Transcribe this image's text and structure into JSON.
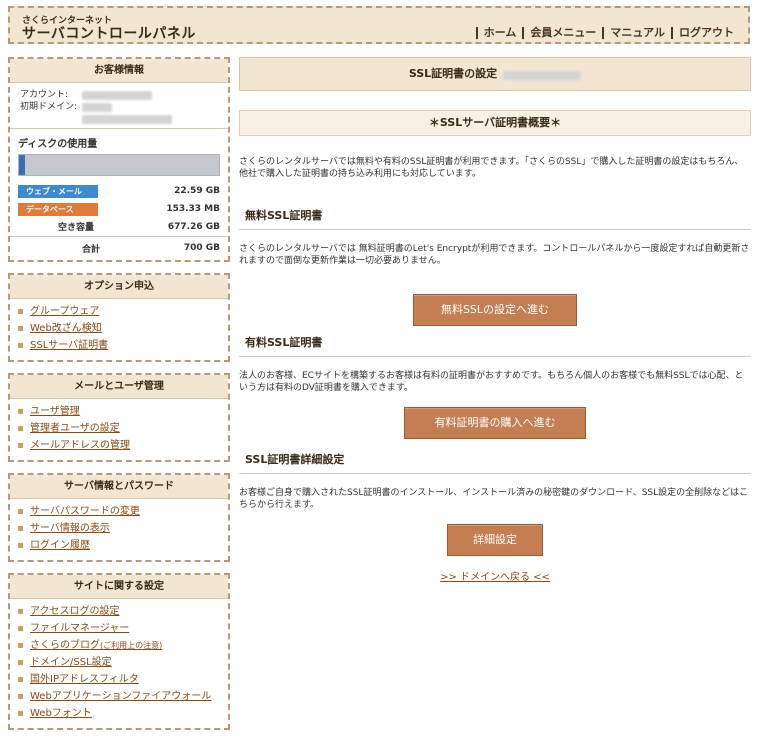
{
  "header": {
    "brand_small": "さくらインターネット",
    "brand_big": "サーバコントロールパネル",
    "nav": [
      "ホーム",
      "会員メニュー",
      "マニュアル",
      "ログアウト"
    ]
  },
  "customer": {
    "title": "お客様情報",
    "account_label": "アカウント:",
    "domain_label": "初期ドメイン:"
  },
  "disk": {
    "title": "ディスクの使用量",
    "usage_fraction": 0.03,
    "rows": [
      {
        "label": "ウェブ・メール",
        "value": "22.59 GB"
      },
      {
        "label": "データベース",
        "value": "153.33 MB"
      }
    ],
    "free_label": "空き容量",
    "free_value": "677.26 GB",
    "total_label": "合計",
    "total_value": "700 GB"
  },
  "menus": {
    "option": {
      "title": "オプション申込",
      "items": [
        "グループウェア",
        "Web改ざん検知",
        "SSLサーバ証明書"
      ]
    },
    "mail": {
      "title": "メールとユーザ管理",
      "items": [
        "ユーザ管理",
        "管理者ユーザの設定",
        "メールアドレスの管理"
      ]
    },
    "server": {
      "title": "サーバ情報とパスワード",
      "items": [
        "サーバパスワードの変更",
        "サーバ情報の表示",
        "ログイン履歴"
      ]
    },
    "site": {
      "title": "サイトに関する設定",
      "items": [
        "アクセスログの設定",
        "ファイルマネージャー",
        "さくらのブログ",
        "ドメイン/SSL設定",
        "国外IPアドレスフィルタ",
        "Webアプリケーションファイアウォール",
        "Webフォント"
      ],
      "blog_note": "(ご利用上の注意)"
    }
  },
  "main": {
    "title": "SSL証明書の設定",
    "overview_title": "＊SSLサーバ証明書概要＊",
    "intro": "さくらのレンタルサーバでは無料や有料のSSL証明書が利用できます。「さくらのSSL」で購入した証明書の設定はもちろん、他社で購入した証明書の持ち込み利用にも対応しています。",
    "free_title": "無料SSL証明書",
    "free_text": "さくらのレンタルサーバでは 無料証明書のLet's Encryptが利用できます。コントロールパネルから一度設定すれば自動更新されますので面倒な更新作業は一切必要ありません。",
    "free_button": "無料SSLの設定へ進む",
    "paid_title": "有料SSL証明書",
    "paid_text": "法人のお客様、ECサイトを構築するお客様は有料の証明書がおすすめです。もちろん個人のお客様でも無料SSLでは心配、という方は有料のDV証明書を購入できます。",
    "paid_button": "有料証明書の購入へ進む",
    "detail_title": "SSL証明書詳細設定",
    "detail_text": "お客様ご自身で購入されたSSL証明書のインストール、インストール済みの秘密鍵のダウンロード、SSL設定の全削除などはこちらから行えます。",
    "detail_button": "詳細設定",
    "back_link": ">> ドメインへ戻る <<"
  }
}
